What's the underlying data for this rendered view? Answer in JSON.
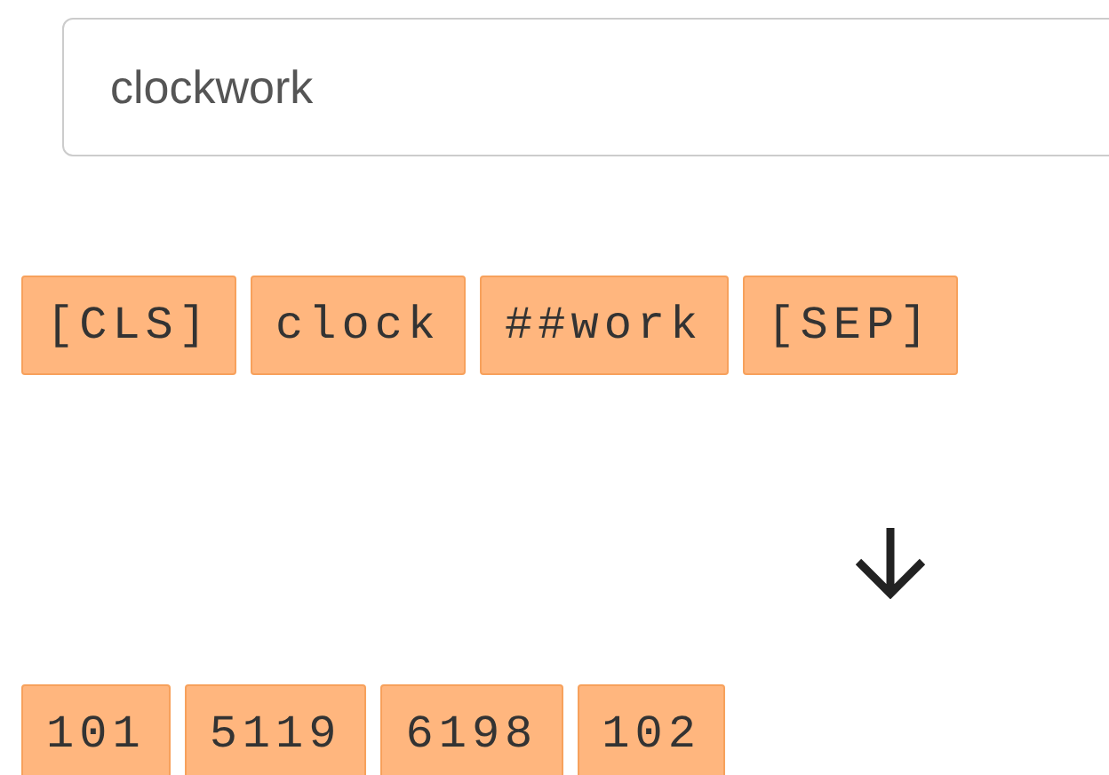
{
  "input": {
    "value": "clockwork"
  },
  "tokens": [
    "[CLS]",
    "clock",
    "##work",
    "[SEP]"
  ],
  "ids": [
    "101",
    "5119",
    "6198",
    "102"
  ]
}
